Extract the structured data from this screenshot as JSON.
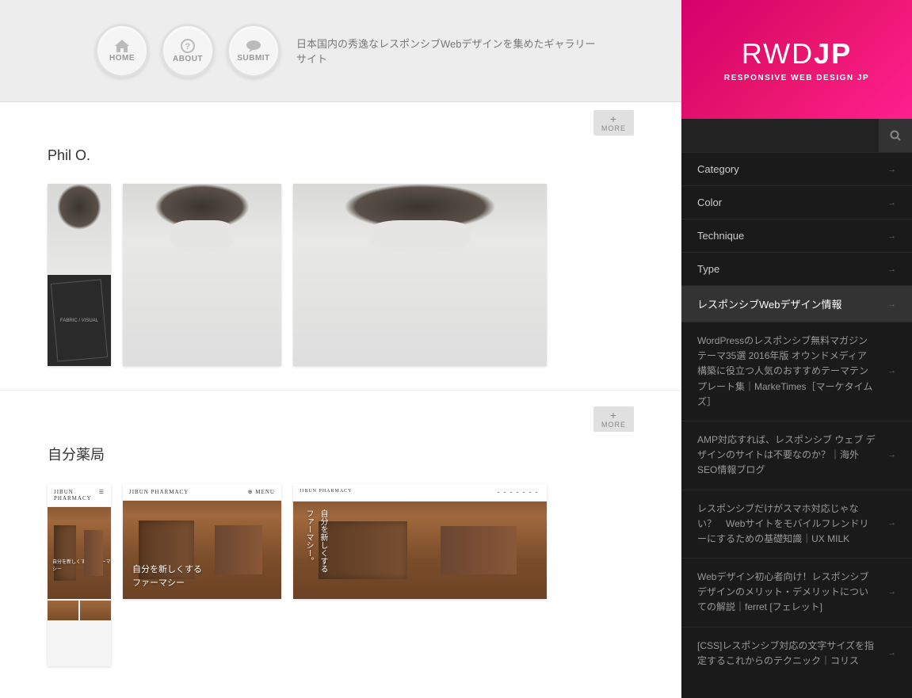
{
  "header": {
    "nav": {
      "home": "HOME",
      "about": "ABOUT",
      "submit": "SUBMIT"
    },
    "tagline": "日本国内の秀逸なレスポンシブWebデザインを集めたギャラリーサイト"
  },
  "more_label": "MORE",
  "items": [
    {
      "title": "Phil O.",
      "pharm_header": "",
      "mob_label": "FABRIC / VISUAL"
    },
    {
      "title": "自分薬局",
      "pharm_header": "JIBUN PHARMACY",
      "tablet_text": "自分を新しくする\nファーマシー",
      "desktop_text": "自分を新しくする\nファーマシー。"
    }
  ],
  "sidebar": {
    "logo": {
      "title_a": "RWD",
      "title_b": "JP",
      "sub": "RESPONSIVE WEB DESIGN JP"
    },
    "search_placeholder": "",
    "menu": [
      {
        "label": "Category",
        "type": "top"
      },
      {
        "label": "Color",
        "type": "top"
      },
      {
        "label": "Technique",
        "type": "top"
      },
      {
        "label": "Type",
        "type": "top"
      },
      {
        "label": "レスポンシブWebデザイン情報",
        "type": "active"
      },
      {
        "label": "WordPressのレスポンシブ無料マガジンテーマ35選 2016年版 オウンドメディア構築に役立つ人気のおすすめテーマテンプレート集｜MarkeTimes［マーケタイムズ］",
        "type": "sub"
      },
      {
        "label": "AMP対応すれば、レスポンシブ ウェブ デザインのサイトは不要なのか？｜海外SEO情報ブログ",
        "type": "sub"
      },
      {
        "label": "レスポンシブだけがスマホ対応じゃない？　Webサイトをモバイルフレンドリーにするための基礎知識｜UX MILK",
        "type": "sub"
      },
      {
        "label": "Webデザイン初心者向け！レスポンシブデザインのメリット・デメリットについての解説｜ferret [フェレット]",
        "type": "sub"
      },
      {
        "label": "[CSS]レスポンシブ対応の文字サイズを指定するこれからのテクニック｜コリス",
        "type": "sub"
      }
    ]
  }
}
